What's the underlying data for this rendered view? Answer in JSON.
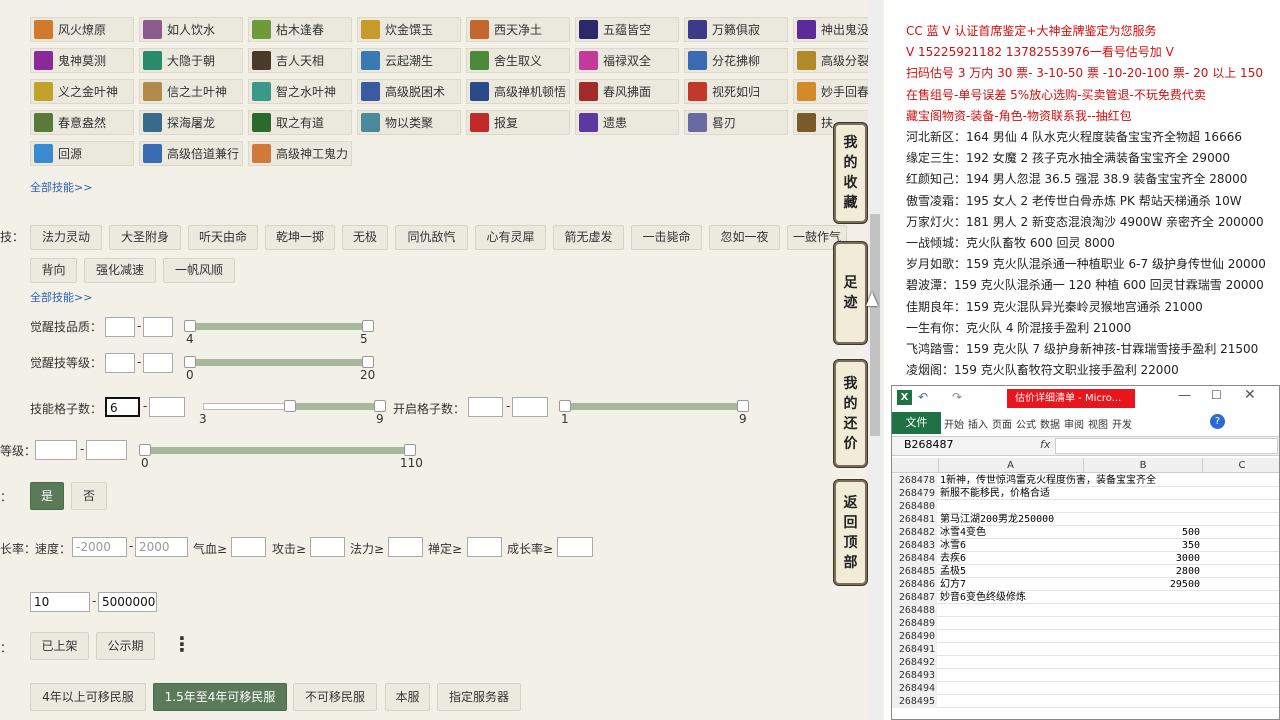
{
  "skills": [
    [
      "风火燎原",
      "如人饮水",
      "枯木逢春",
      "炊金馔玉",
      "西天净土",
      "五蕴皆空",
      "万籁俱寂",
      "神出鬼没"
    ],
    [
      "鬼神莫测",
      "大隐于朝",
      "吉人天相",
      "云起潮生",
      "舍生取义",
      "福禄双全",
      "分花拂柳",
      "高级分裂"
    ],
    [
      "义之金叶神",
      "信之土叶神",
      "智之水叶神",
      "高级脱困术",
      "高级禅机顿悟",
      "春风拂面",
      "视死如归",
      "妙手回春"
    ],
    [
      "春意盎然",
      "探海屠龙",
      "取之有道",
      "物以类聚",
      "报复",
      "遗患",
      "晷刃",
      "扶"
    ],
    [
      "回源",
      "高级倍道兼行",
      "高级神工鬼力"
    ]
  ],
  "skill_colors": [
    [
      "#d27a2c",
      "#8b5b8d",
      "#6f9a3a",
      "#c89a2a",
      "#c2672d",
      "#2a2a6a",
      "#3b3b8a",
      "#5b2b9a"
    ],
    [
      "#8a2a9a",
      "#2a8a6a",
      "#4a3a2a",
      "#3a7ab2",
      "#4a8a3a",
      "#c23a9a",
      "#3a6ab2",
      "#b28a2a"
    ],
    [
      "#c2a22a",
      "#b28a4a",
      "#3a9a8a",
      "#3a5aa2",
      "#2a4a8a",
      "#a22a2a",
      "#c2382a",
      "#d28a2a"
    ],
    [
      "#5a7a3a",
      "#3a6a8a",
      "#2a6a2a",
      "#4a8a9a",
      "#c22a2a",
      "#5a3aa2",
      "#6a6aa2",
      "#7a5a2a"
    ],
    [
      "#3a8ad2",
      "#3a6ab2",
      "#d27a3a"
    ]
  ],
  "all_skills_link": "全部技能>>",
  "jj_label": "技：",
  "jj_row1": [
    "法力灵动",
    "大圣附身",
    "听天由命",
    "乾坤一掷",
    "无极",
    "同仇敌忾",
    "心有灵犀",
    "箭无虚发",
    "一击毙命",
    "忽如一夜",
    "一鼓作气"
  ],
  "jj_row2": [
    "背向",
    "强化减速",
    "一帆风顺"
  ],
  "jj_link": "全部技能>>",
  "awake_quality": {
    "label": "觉醒技品质：",
    "min": 4,
    "max": 5
  },
  "awake_level": {
    "label": "觉醒技等级：",
    "min": 0,
    "max": 20
  },
  "slots": {
    "label": "技能格子数：",
    "value": "6",
    "min": 3,
    "max": 9,
    "low": 6
  },
  "open_slots": {
    "label": "开启格子数：",
    "min": 1,
    "max": 9
  },
  "level": {
    "label": "等级：",
    "min": 0,
    "max": 110
  },
  "yesno": {
    "label": "：",
    "yes": "是",
    "no": "否"
  },
  "growth": {
    "label": "长率：",
    "speed": "速度：",
    "ph1": "-2000",
    "ph2": "2000",
    "qixue": "气血≥",
    "gongji": "攻击≥",
    "fali": "法力≥",
    "chanding": "禅定≥",
    "chengzhang": "成长率≥"
  },
  "price": {
    "min": "10",
    "max": "5000000"
  },
  "status": {
    "label": "：",
    "b1": "已上架",
    "b2": "公示期",
    "more": "⋮"
  },
  "server_tags": [
    "4年以上可移民服",
    "1.5年至4年可移民服",
    "不可移民服",
    "本服",
    "指定服务器"
  ],
  "side_tabs": [
    [
      "我",
      "的",
      "收",
      "藏"
    ],
    [
      "足",
      "迹"
    ],
    [
      "我",
      "的",
      "还",
      "价"
    ],
    [
      "返",
      "回",
      "顶",
      "部"
    ]
  ],
  "notes": [
    {
      "t": "CC 蓝 V 认证首席鉴定+大神金牌鉴定为您服务",
      "c": "red"
    },
    {
      "t": "V 15225921182      13782553976一看号估号加 V",
      "c": "red"
    },
    {
      "t": "扫码估号 3 万内 30 票- 3-10-50 票  -10-20-100 票- 20 以上 150",
      "c": "red"
    },
    {
      "t": "在售组号-单号误差 5%放心选购-买卖管退-不玩免费代卖",
      "c": "red"
    },
    {
      "t": "藏宝阁物资-装备-角色-物资联系我--抽红包",
      "c": "red"
    },
    {
      "t": "河北新区：164 男仙 4 队水克火程度装备宝宝齐全物超 16666",
      "c": "b"
    },
    {
      "t": "缘定三生：192 女魔 2 孩子克水抽全满装备宝宝齐全 29000",
      "c": "b"
    },
    {
      "t": "红颜知己：194 男人忽混 36.5 强混 38.9 装备宝宝齐全 28000",
      "c": "b"
    },
    {
      "t": "傲雪凌霜：195 女人 2 老传世白骨赤炼 PK 帮站天梯通杀 10W",
      "c": "b"
    },
    {
      "t": "万家灯火：181 男人 2 新变态混浪淘沙 4900W 亲密齐全 200000",
      "c": "b"
    },
    {
      "t": "一战倾城：克火队畜牧 600 回灵 8000",
      "c": "b"
    },
    {
      "t": "岁月如歌：159 克火队混杀通一种植职业 6-7 级护身传世仙 20000",
      "c": "b"
    },
    {
      "t": "碧波潭：159 克火队混杀通一 120 种植 600 回灵甘霖瑞雪 20000",
      "c": "b"
    },
    {
      "t": "佳期良年：159 克火混队异光秦岭灵猴地宫通杀 21000",
      "c": "b"
    },
    {
      "t": "一生有你：克火队 4 阶混接手盈利 21000",
      "c": "b"
    },
    {
      "t": "飞鸿踏雪：159 克火队 7 级护身新神孩-甘霖瑞雪接手盈利 21500",
      "c": "b"
    },
    {
      "t": "凌烟阁：159 克火队畜牧符文职业接手盈利 22000",
      "c": "b"
    }
  ],
  "excel": {
    "title": "估价详细清单 - Micro...",
    "file_tab": "文件",
    "ribbon_tabs": [
      "开始",
      "插入",
      "页面",
      "公式",
      "数据",
      "审阅",
      "视图",
      "开发"
    ],
    "namebox": "B268487",
    "fx": "fx",
    "cols": [
      "A",
      "B",
      "C"
    ],
    "rows": [
      {
        "n": "268478",
        "a": "1新神，传世惊鸿雷克火程度伤害，装备宝宝齐全",
        "b": ""
      },
      {
        "n": "268479",
        "a": "新服不能移民，价格合适",
        "b": ""
      },
      {
        "n": "268480",
        "a": "",
        "b": ""
      },
      {
        "n": "268481",
        "a": "第马江湖200男龙250000",
        "b": ""
      },
      {
        "n": "268482",
        "a": "冰雪4变色",
        "b": "500"
      },
      {
        "n": "268483",
        "a": "冰雪6",
        "b": "350"
      },
      {
        "n": "268484",
        "a": "去疾6",
        "b": "3000"
      },
      {
        "n": "268485",
        "a": "孟极5",
        "b": "2800"
      },
      {
        "n": "268486",
        "a": "幻方7",
        "b": "29500"
      },
      {
        "n": "268487",
        "a": "妙音6变色终级修炼",
        "b": ""
      },
      {
        "n": "268488",
        "a": "",
        "b": ""
      },
      {
        "n": "268489",
        "a": "",
        "b": ""
      },
      {
        "n": "268490",
        "a": "",
        "b": ""
      },
      {
        "n": "268491",
        "a": "",
        "b": ""
      },
      {
        "n": "268492",
        "a": "",
        "b": ""
      },
      {
        "n": "268493",
        "a": "",
        "b": ""
      },
      {
        "n": "268494",
        "a": "",
        "b": ""
      },
      {
        "n": "268495",
        "a": "",
        "b": ""
      }
    ]
  }
}
